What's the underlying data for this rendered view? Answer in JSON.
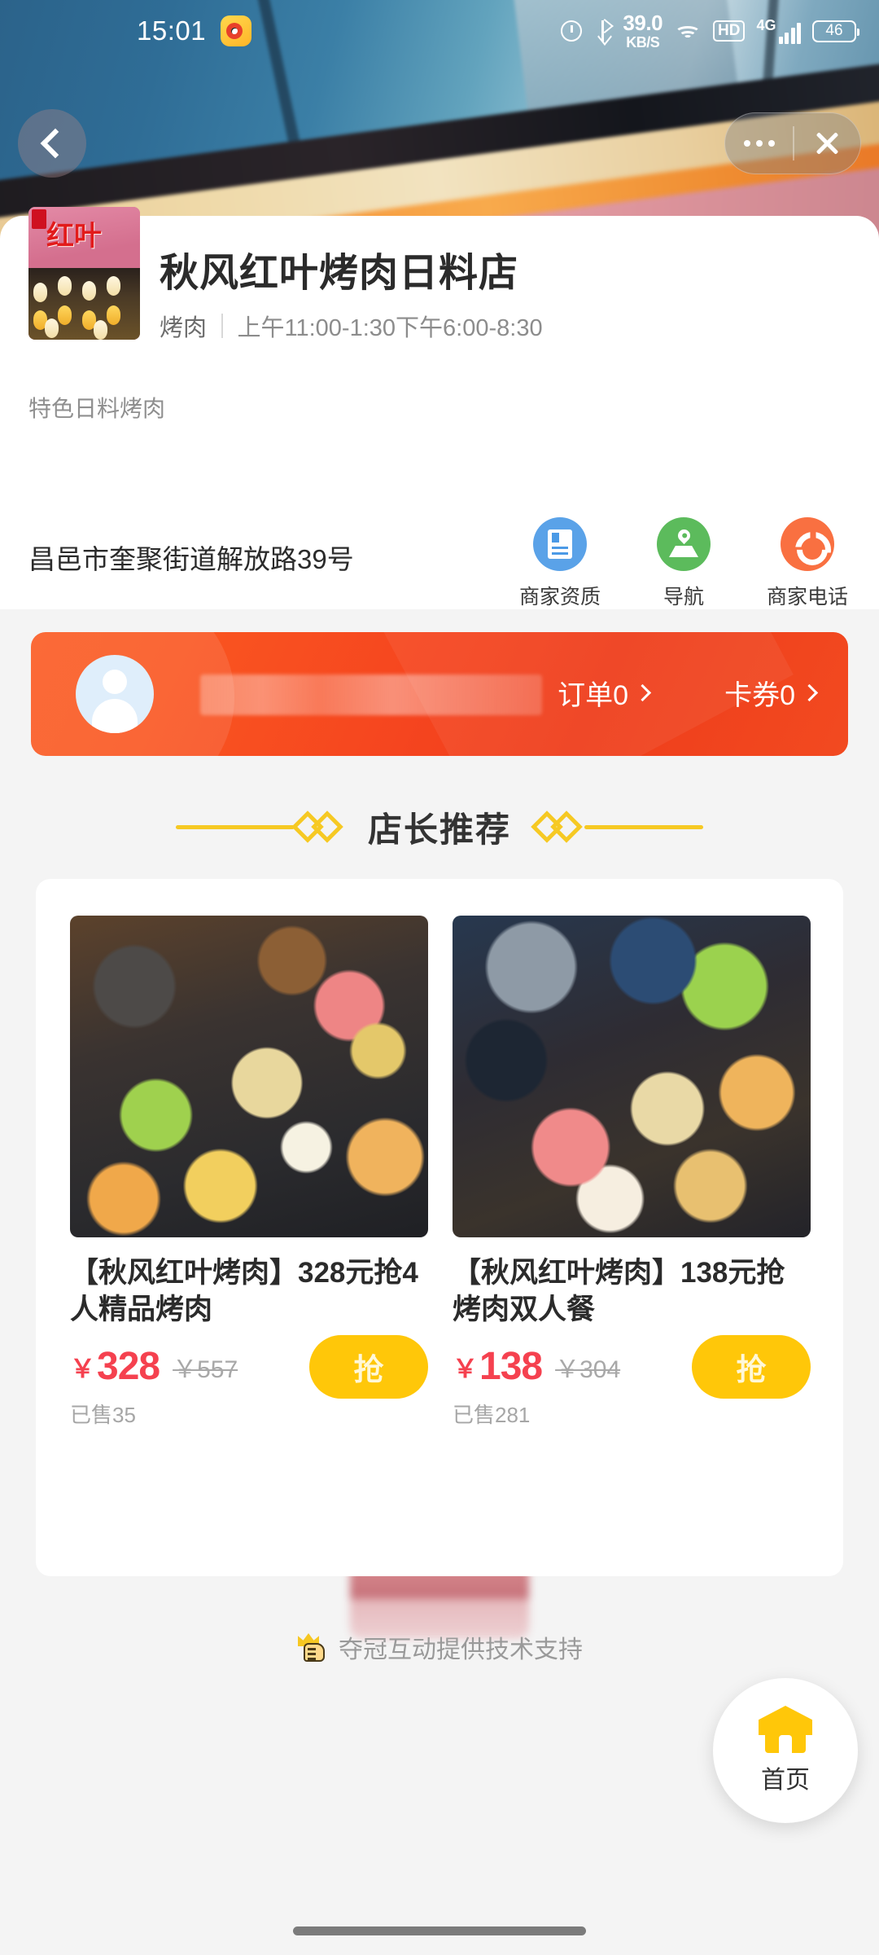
{
  "status_bar": {
    "time": "15:01",
    "app_icon": "weibo-icon",
    "alarm_icon": "alarm-icon",
    "bluetooth_icon": "bluetooth-icon",
    "net_speed": "39.0",
    "net_speed_unit": "KB/S",
    "wifi_icon": "wifi-icon",
    "hd_label": "HD",
    "network_label": "4G",
    "signal_icon": "signal-bars-icon",
    "battery_level": "46"
  },
  "top_nav": {
    "back_icon": "back-chevron-icon",
    "more_icon": "more-dots-icon",
    "close_icon": "close-x-icon"
  },
  "shop": {
    "thumb_alt": "storefront-photo",
    "name": "秋风红叶烤肉日料店",
    "category": "烤肉",
    "hours": "上午11:00-1:30下午6:00-8:30",
    "tagline": "特色日料烤肉",
    "address": "昌邑市奎聚街道解放路39号",
    "actions": [
      {
        "label": "商家资质",
        "icon": "license-card-icon",
        "color": "#5aa2e8"
      },
      {
        "label": "导航",
        "icon": "map-pin-icon",
        "color": "#5cbb5c"
      },
      {
        "label": "商家电话",
        "icon": "phone-icon",
        "color": "#f97041"
      }
    ]
  },
  "user_bar": {
    "avatar_icon": "user-avatar-icon",
    "username": "",
    "orders_label": "订单0",
    "coupons_label": "卡券0",
    "bg_color": "#f5451f"
  },
  "section": {
    "title": "店长推荐",
    "accent_color": "#f6c923"
  },
  "products": [
    {
      "image_alt": "烤肉套餐图片一",
      "title": "【秋风红叶烤肉】328元抢4人精品烤肉",
      "currency": "￥",
      "price": "328",
      "original_price": "￥557",
      "sold": "已售35",
      "buy_label": "抢"
    },
    {
      "image_alt": "烤肉套餐图片二",
      "title": "【秋风红叶烤肉】138元抢烤肉双人餐",
      "currency": "￥",
      "price": "138",
      "original_price": "￥304",
      "sold": "已售281",
      "buy_label": "抢"
    }
  ],
  "footer": {
    "logo_alt": "blurred-brand-logo",
    "icon": "crown-hand-icon",
    "credit": "夺冠互动提供技术支持"
  },
  "home_fab": {
    "icon": "home-icon",
    "label": "首页"
  }
}
